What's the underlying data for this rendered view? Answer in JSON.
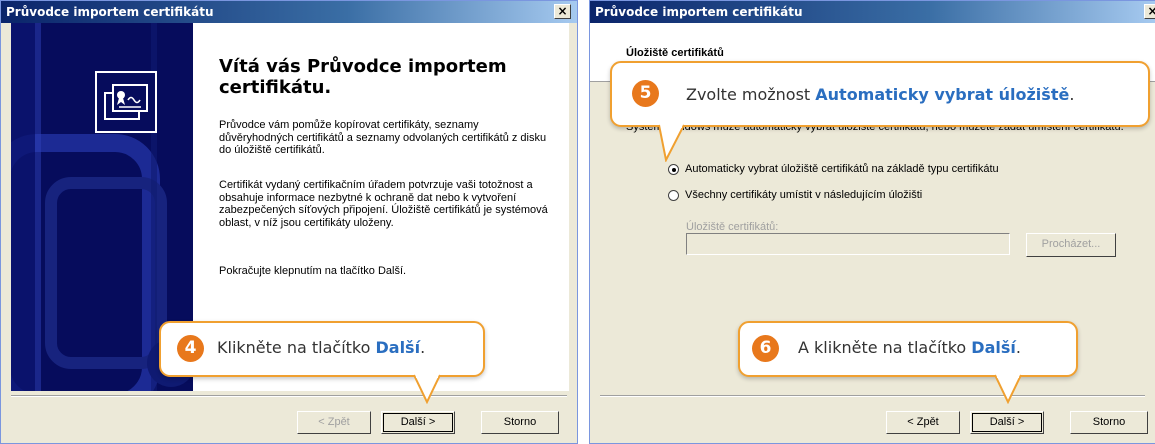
{
  "left_window": {
    "title": "Průvodce importem certifikátu",
    "close_label": "×",
    "heading": "Vítá vás Průvodce importem certifikátu.",
    "paragraph1": "Průvodce vám pomůže kopírovat certifikáty, seznamy důvěryhodných certifikátů a seznamy odvolaných certifikátů z disku do úložiště certifikátů.",
    "paragraph2": "Certifikát vydaný certifikačním úřadem potvrzuje vaši totožnost a obsahuje informace nezbytné k ochraně dat nebo k vytvoření zabezpečených síťových připojení. Úložiště certifikátů je systémová oblast, v níž jsou certifikáty uloženy.",
    "paragraph3": "Pokračujte klepnutím na tlačítko Další.",
    "buttons": {
      "back": "< Zpět",
      "next": "Další >",
      "cancel": "Storno"
    },
    "callout": {
      "number": "4",
      "text": "Klikněte na tlačítko ",
      "highlight": "Další",
      "suffix": "."
    }
  },
  "right_window": {
    "title": "Průvodce importem certifikátu",
    "close_label": "×",
    "header_title": "Úložiště certifikátů",
    "description": "Systém Windows může automaticky vybrat úložiště certifikátu, nebo můžete zadat umístění certifikátu.",
    "radio_auto": "Automaticky vybrat úložiště certifikátů na základě typu certifikátu",
    "radio_manual": "Všechny certifikáty umístit v následujícím úložišti",
    "store_label": "Úložiště certifikátů:",
    "store_value": "",
    "browse": "Procházet...",
    "buttons": {
      "back": "< Zpět",
      "next": "Další >",
      "cancel": "Storno"
    },
    "callout_top": {
      "number": "5",
      "text": "Zvolte možnost ",
      "highlight": "Automaticky vybrat úložiště",
      "suffix": "."
    },
    "callout_bottom": {
      "number": "6",
      "text": "A klikněte na tlačítko ",
      "highlight": "Další",
      "suffix": "."
    }
  },
  "colors": {
    "accent_orange": "#e8781c",
    "callout_border": "#f0a030",
    "highlight_blue": "#2a6ec0",
    "titlebar": "#0a246a"
  },
  "icons": [
    "certificate-icon",
    "close-icon"
  ],
  "selected_radio": "radio_auto"
}
